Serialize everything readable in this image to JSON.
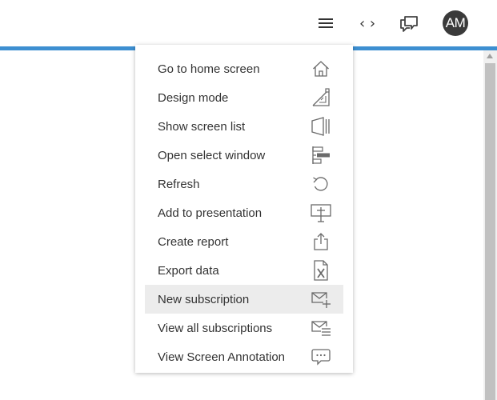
{
  "colors": {
    "accent": "#3d8fd1",
    "avatar_bg": "#3a3a3a",
    "icon": "#444444",
    "menu_icon": "#6a6a6a"
  },
  "toolbar": {
    "menu_icon": "hamburger-icon",
    "code_label": "‹ ›",
    "chat_icon": "comments-icon",
    "avatar_initials": "AM"
  },
  "menu": {
    "items": [
      {
        "label": "Go to home screen",
        "icon": "home-icon"
      },
      {
        "label": "Design mode",
        "icon": "design-mode-icon"
      },
      {
        "label": "Show screen list",
        "icon": "screen-list-icon"
      },
      {
        "label": "Open select window",
        "icon": "select-window-icon"
      },
      {
        "label": "Refresh",
        "icon": "refresh-icon"
      },
      {
        "label": "Add to presentation",
        "icon": "presentation-icon"
      },
      {
        "label": "Create report",
        "icon": "share-export-icon"
      },
      {
        "label": "Export data",
        "icon": "excel-file-icon"
      },
      {
        "label": "New subscription",
        "icon": "mail-plus-icon",
        "highlighted": true
      },
      {
        "label": "View all subscriptions",
        "icon": "mail-list-icon"
      },
      {
        "label": "View Screen Annotation",
        "icon": "annotation-bubble-icon"
      }
    ]
  }
}
